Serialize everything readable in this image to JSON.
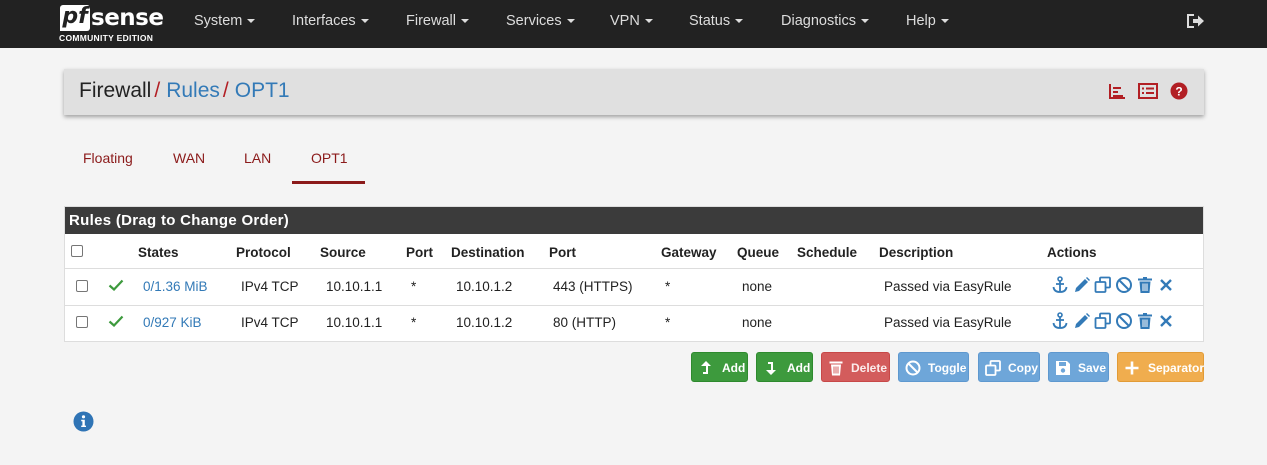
{
  "brand": {
    "name": "sense",
    "mark": "pf",
    "edition": "COMMUNITY EDITION"
  },
  "nav": {
    "items": [
      {
        "label": "System"
      },
      {
        "label": "Interfaces"
      },
      {
        "label": "Firewall"
      },
      {
        "label": "Services"
      },
      {
        "label": "VPN"
      },
      {
        "label": "Status"
      },
      {
        "label": "Diagnostics"
      },
      {
        "label": "Help"
      }
    ],
    "logout_icon": "sign-out-icon"
  },
  "breadcrumb": {
    "root": "Firewall",
    "sep": "/",
    "level1": "Rules",
    "level2": "OPT1"
  },
  "breadcrumb_icons": [
    "bar-chart-icon",
    "list-icon",
    "help-icon"
  ],
  "tabs": [
    {
      "label": "Floating"
    },
    {
      "label": "WAN"
    },
    {
      "label": "LAN"
    },
    {
      "label": "OPT1",
      "active": true
    }
  ],
  "rules_panel": {
    "title": "Rules (Drag to Change Order)",
    "headers": {
      "states": "States",
      "protocol": "Protocol",
      "source": "Source",
      "port": "Port",
      "destination": "Destination",
      "dport": "Port",
      "gateway": "Gateway",
      "queue": "Queue",
      "schedule": "Schedule",
      "description": "Description",
      "actions": "Actions"
    },
    "rows": [
      {
        "states": "0/1.36 MiB",
        "protocol": "IPv4 TCP",
        "source": "10.10.1.1",
        "port": "*",
        "destination": "10.10.1.2",
        "dport": "443 (HTTPS)",
        "gateway": "*",
        "queue": "none",
        "schedule": "",
        "description": "Passed via EasyRule"
      },
      {
        "states": "0/927 KiB",
        "protocol": "IPv4 TCP",
        "source": "10.10.1.1",
        "port": "*",
        "destination": "10.10.1.2",
        "dport": "80 (HTTP)",
        "gateway": "*",
        "queue": "none",
        "schedule": "",
        "description": "Passed via EasyRule"
      }
    ]
  },
  "buttons": {
    "add_top": "Add",
    "add_bottom": "Add",
    "delete": "Delete",
    "toggle": "Toggle",
    "copy": "Copy",
    "save": "Save",
    "separator": "Separator"
  },
  "colors": {
    "navbar": "#222222",
    "accent_red": "#8b1a1a",
    "link_blue": "#337ab7",
    "pass_green": "#3d9a3d",
    "orange": "#f0ad4e"
  }
}
